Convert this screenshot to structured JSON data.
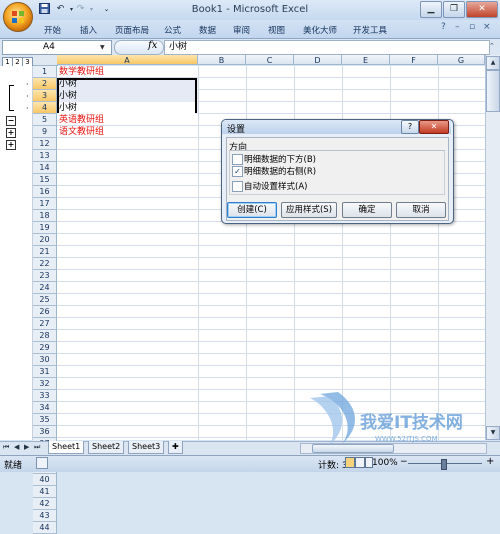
{
  "window": {
    "title": "Book1 - Microsoft Excel"
  },
  "quick_access": [
    "save-icon",
    "undo-icon",
    "redo-icon",
    "customize-icon"
  ],
  "ribbon": {
    "tabs": [
      "开始",
      "插入",
      "页面布局",
      "公式",
      "数据",
      "审阅",
      "视图",
      "美化大师",
      "开发工具"
    ]
  },
  "formula_bar": {
    "name_box": "A4",
    "fx": "fx",
    "content": "小树"
  },
  "outline": {
    "levels": [
      "1",
      "2",
      "3"
    ]
  },
  "columns": [
    "A",
    "B",
    "C",
    "D",
    "E",
    "F",
    "G"
  ],
  "rows": [
    "1",
    "2",
    "3",
    "4",
    "5",
    "9",
    "12",
    "13",
    "14",
    "15",
    "16",
    "17",
    "18",
    "19",
    "20",
    "21",
    "22",
    "23",
    "24",
    "25",
    "26",
    "27",
    "28",
    "29",
    "30",
    "31",
    "32",
    "33",
    "34",
    "35",
    "36",
    "37",
    "38",
    "39",
    "40",
    "41",
    "42",
    "43",
    "44"
  ],
  "cells": {
    "a1": "数学教研组",
    "a2": "小树",
    "a3": "小树",
    "a4": "小树",
    "a5": "英语教研组",
    "a9": "语文教研组"
  },
  "sheets": [
    "Sheet1",
    "Sheet2",
    "Sheet3"
  ],
  "status": {
    "mode": "就绪",
    "count": "计数: 3",
    "zoom": "100%"
  },
  "dialog": {
    "title": "设置",
    "group": "方向",
    "options": [
      {
        "label": "明细数据的下方(B)",
        "checked": false
      },
      {
        "label": "明细数据的右侧(R)",
        "checked": true
      },
      {
        "label": "自动设置样式(A)",
        "checked": false
      }
    ],
    "buttons": {
      "create": "创建(C)",
      "apply": "应用样式(S)",
      "ok": "确定",
      "cancel": "取消"
    }
  },
  "watermark": {
    "text": "我爱IT技术网",
    "sub": "WWW.52ITJS.COM"
  },
  "colors": {
    "red_text": "#e8140f",
    "selection_header": "#f8c767",
    "ribbon": "#c2d6ee"
  }
}
